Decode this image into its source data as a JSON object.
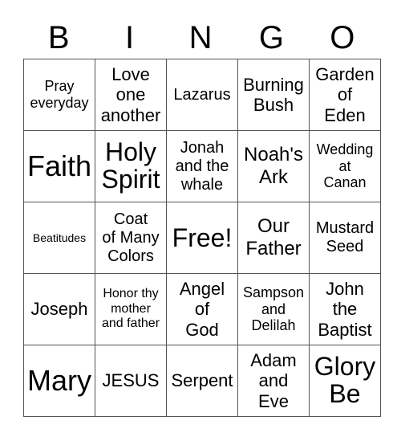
{
  "header": [
    "B",
    "I",
    "N",
    "G",
    "O"
  ],
  "rows": [
    [
      "Pray\neveryday",
      "Love\none\nanother",
      "Lazarus",
      "Burning\nBush",
      "Garden\nof\nEden"
    ],
    [
      "Faith",
      "Holy\nSpirit",
      "Jonah\nand the\nwhale",
      "Noah's\nArk",
      "Wedding\nat\nCanan"
    ],
    [
      "Beatitudes",
      "Coat\nof Many\nColors",
      "Free!",
      "Our\nFather",
      "Mustard\nSeed"
    ],
    [
      "Joseph",
      "Honor thy\nmother\nand father",
      "Angel\nof\nGod",
      "Sampson\nand\nDelilah",
      "John\nthe\nBaptist"
    ],
    [
      "Mary",
      "JESUS",
      "Serpent",
      "Adam\nand\nEve",
      "Glory\nBe"
    ]
  ]
}
